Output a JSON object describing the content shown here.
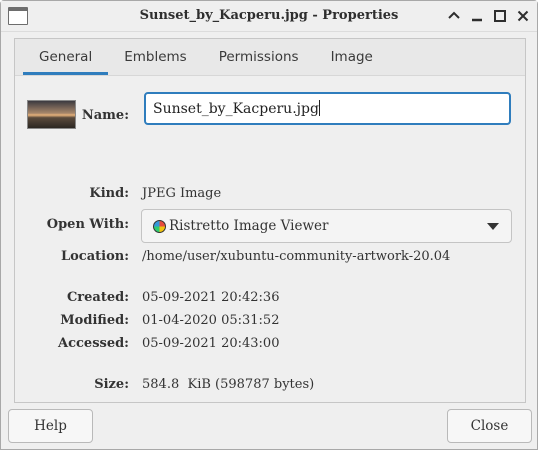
{
  "window": {
    "title": "Sunset_by_Kacperu.jpg - Properties"
  },
  "tabs": [
    {
      "label": "General"
    },
    {
      "label": "Emblems"
    },
    {
      "label": "Permissions"
    },
    {
      "label": "Image"
    }
  ],
  "general": {
    "name_label": "Name:",
    "name_value": "Sunset_by_Kacperu.jpg",
    "kind_label": "Kind:",
    "kind_value": "JPEG Image",
    "open_with_label": "Open With:",
    "open_with_value": "Ristretto Image Viewer",
    "location_label": "Location:",
    "location_value": "/home/user/xubuntu-community-artwork-20.04",
    "created_label": "Created:",
    "created_value": "05-09-2021 20:42:36",
    "modified_label": "Modified:",
    "modified_value": "01-04-2020 05:31:52",
    "accessed_label": "Accessed:",
    "accessed_value": "05-09-2021 20:43:00",
    "size_label": "Size:",
    "size_value": "584.8  KiB (598787 bytes)"
  },
  "buttons": {
    "help": "Help",
    "close": "Close"
  },
  "icons": {
    "window": "window-icon",
    "titlebar": [
      "chevron-up-icon",
      "minimize-icon",
      "maximize-icon",
      "close-icon"
    ],
    "thumbnail": "image-thumbnail",
    "app": "ristretto-icon",
    "dropdown": "dropdown-arrow-icon"
  },
  "colors": {
    "accent": "#2f7dbd"
  }
}
